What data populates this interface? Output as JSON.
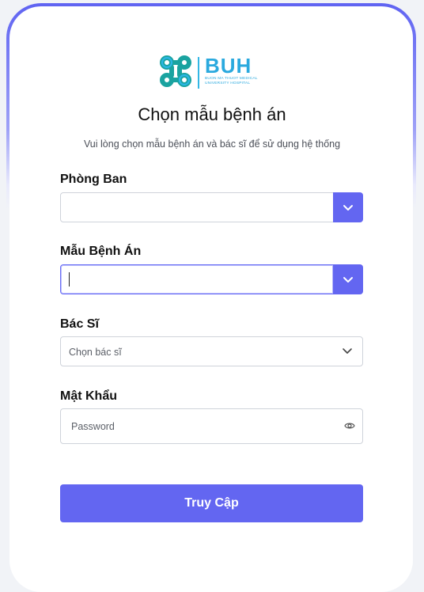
{
  "logo": {
    "abbr": "BUH",
    "line1": "BUON MA THUOT MEDICAL",
    "line2": "UNIVERSITY HOSPITAL"
  },
  "page": {
    "title": "Chọn mẫu bệnh án",
    "subtitle": "Vui lòng chọn mẫu bệnh án và bác sĩ để sử dụng hệ thống"
  },
  "form": {
    "department": {
      "label": "Phòng Ban",
      "value": ""
    },
    "template": {
      "label": "Mẫu Bệnh Án",
      "value": ""
    },
    "doctor": {
      "label": "Bác Sĩ",
      "placeholder": "Chọn bác sĩ"
    },
    "password": {
      "label": "Mật Khẩu",
      "placeholder": "Password"
    },
    "submit_label": "Truy Cập"
  },
  "colors": {
    "accent": "#6366f1",
    "logo": "#2aa9de",
    "logo_dark": "#1a9a8a"
  },
  "icons": {
    "dropdown": "chevron-down-icon",
    "password_toggle": "eye-icon",
    "logo_mark": "hospital-logo-icon"
  }
}
